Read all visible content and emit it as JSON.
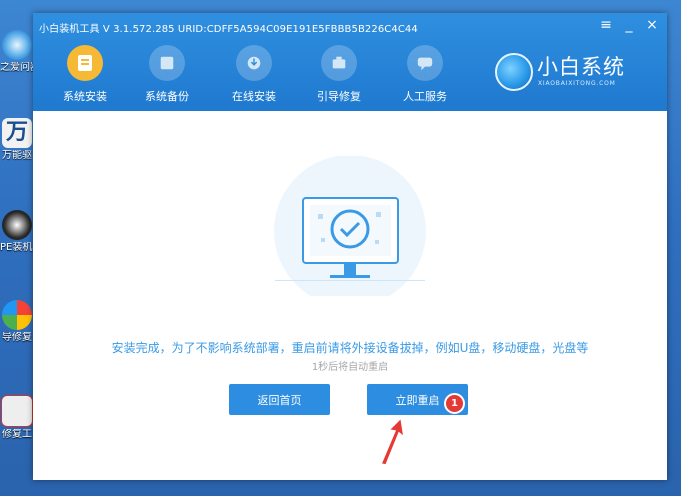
{
  "window": {
    "title": "小白装机工具 V 3.1.572.285 URID:CDFF5A594C09E191E5FBBB5B226C4C44",
    "controls": {
      "menu": "≡",
      "minimize": "_",
      "close": "×"
    }
  },
  "nav": {
    "items": [
      {
        "label": "系统安装",
        "icon": "install-icon",
        "active": true
      },
      {
        "label": "系统备份",
        "icon": "backup-icon",
        "active": false
      },
      {
        "label": "在线安装",
        "icon": "online-install-icon",
        "active": false
      },
      {
        "label": "引导修复",
        "icon": "boot-repair-icon",
        "active": false
      },
      {
        "label": "人工服务",
        "icon": "chat-service-icon",
        "active": false
      }
    ]
  },
  "brand": {
    "name": "小白系统",
    "subtitle": "XIAOBAIXITONG.COM"
  },
  "content": {
    "message": "安装完成，为了不影响系统部署，重启前请将外接设备拔掉，例如U盘，移动硬盘，光盘等",
    "countdown": "1秒后将自动重启",
    "back_button": "返回首页",
    "restart_button": "立即重启",
    "badge": "1"
  },
  "desktop": {
    "icons": [
      {
        "label": "之爱问器"
      },
      {
        "label": "万能驱"
      },
      {
        "label": "PE装机具"
      },
      {
        "label": "导修复"
      },
      {
        "label": "修复工"
      }
    ]
  },
  "colors": {
    "header": "#1f79cf",
    "accent": "#2d8de0",
    "active_nav": "#f5b935",
    "message_text": "#3a9ae6",
    "badge": "#e53935"
  }
}
